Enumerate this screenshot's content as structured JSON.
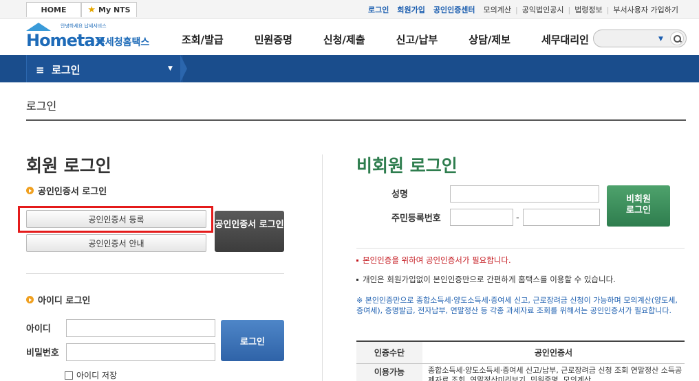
{
  "top": {
    "home": "HOME",
    "mynts": "My NTS",
    "links": [
      "로그인",
      "회원가입",
      "공인인증센터",
      "모의계산",
      "공익법인공시",
      "법령정보",
      "부서사용자 가입하기"
    ]
  },
  "logo": {
    "small": "안녕하세요 납세서비스",
    "word": "Hometax",
    "kr": "국세청홈택스"
  },
  "gnb": [
    "조회/발급",
    "민원증명",
    "신청/제출",
    "신고/납부",
    "상담/제보",
    "세무대리인"
  ],
  "nav": {
    "menu": "로그인"
  },
  "page_title": "로그인",
  "member": {
    "title": "회원 로그인",
    "cert_section": "공인인증서 로그인",
    "cert_register": "공인인증서 등록",
    "cert_guide": "공인인증서 안내",
    "cert_login": "공인인증서 로그인",
    "id_section": "아이디 로그인",
    "id_label": "아이디",
    "pw_label": "비밀번호",
    "login_btn": "로그인",
    "save_id": "아이디 저장"
  },
  "guest": {
    "title": "비회원 로그인",
    "name_label": "성명",
    "rrn_label": "주민등록번호",
    "dash": "-",
    "login_btn": "비회원 로그인",
    "note_red": "본인인증을 위하여 공인인증서가 필요합니다.",
    "note_black": "개인은 회원가입없이 본인인증만으로 간편하게 홈택스를 이용할 수 있습니다.",
    "note_blue": "※ 본인인증만으로 종합소득세·양도소득세·증여세 신고, 근로장려금 신청이 가능하며 모의계산(양도세,증여세), 증명발급, 전자납부, 연말정산 등 각종 과세자료 조회를 위해서는 공인인증서가 필요합니다.",
    "table": {
      "headers": [
        "인증수단",
        "공인인증서"
      ],
      "row_label": "이용가능",
      "row_text": "종합소득세·양도소득세·증여세 신고/납부, 근로장려금 신청 조회 연말정산 소득공제자료 조회, 연말정산미리보기, 민원증명, 모의계산"
    }
  }
}
